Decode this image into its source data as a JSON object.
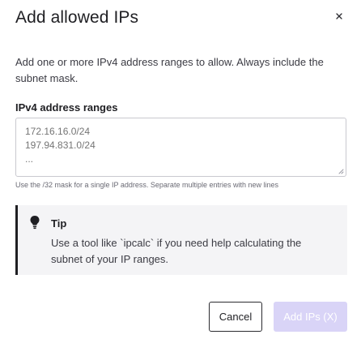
{
  "dialog": {
    "title": "Add allowed IPs",
    "description": "Add one or more IPv4 address ranges to allow. Always include the subnet mask.",
    "close_icon": "close-icon"
  },
  "field": {
    "label": "IPv4 address ranges",
    "value": "",
    "placeholder": "172.16.16.0/24\n197.94.831.0/24\n...",
    "helper": "Use the /32 mask for a single IP address. Separate multiple entries with new lines"
  },
  "tip": {
    "icon": "lightbulb-icon",
    "title": "Tip",
    "text": "Use a tool like `ipcalc` if you need help calculating the subnet of your IP ranges."
  },
  "actions": {
    "cancel_label": "Cancel",
    "add_label": "Add IPs (X)"
  },
  "colors": {
    "accent_disabled": "#d9d4f7",
    "tip_background": "#f4f4f6",
    "tip_border": "#1f1f23"
  }
}
